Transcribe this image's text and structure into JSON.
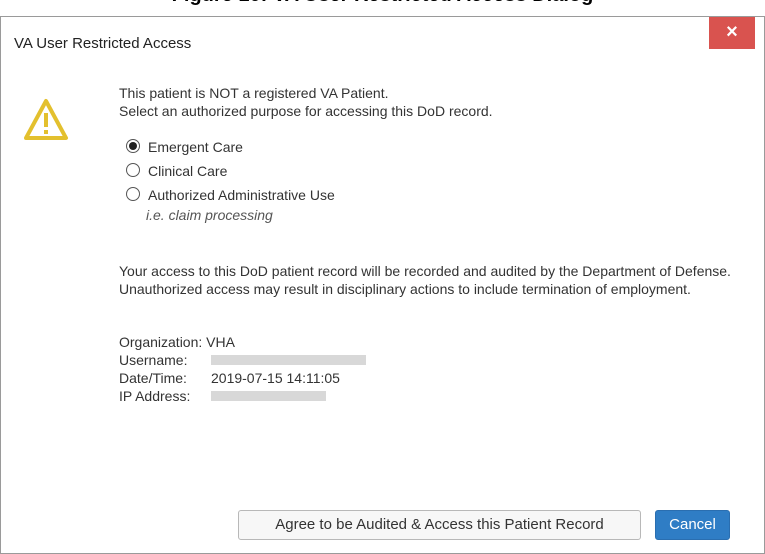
{
  "caption": "Figure 10: VA User Restricted Access Dialog",
  "dialog": {
    "title": "VA User Restricted Access",
    "close_label": "×"
  },
  "message": {
    "line1": "This patient is NOT a registered VA Patient.",
    "line2": "Select an authorized purpose for accessing this DoD record."
  },
  "options": [
    {
      "label": "Emergent Care",
      "checked": true
    },
    {
      "label": "Clinical Care",
      "checked": false
    },
    {
      "label": "Authorized Administrative Use",
      "checked": false,
      "note": "i.e. claim processing"
    }
  ],
  "audit_text": "Your access to this DoD patient record will be recorded and audited by the Department of Defense. Unauthorized access may result in disciplinary actions to include termination of employment.",
  "info": {
    "organization_label": "Organization:",
    "organization_value": "VHA",
    "username_label": "Username:",
    "datetime_label": "Date/Time:",
    "datetime_value": "2019-07-15 14:11:05",
    "ip_label": "IP Address:"
  },
  "buttons": {
    "agree": "Agree to be Audited & Access this Patient Record",
    "cancel": "Cancel"
  },
  "colors": {
    "close_button": "#d9534f",
    "cancel_button": "#2f7dc5",
    "warning_icon": "#e3c02e"
  },
  "icons": [
    "warning-icon",
    "close-icon",
    "radio-icon"
  ]
}
